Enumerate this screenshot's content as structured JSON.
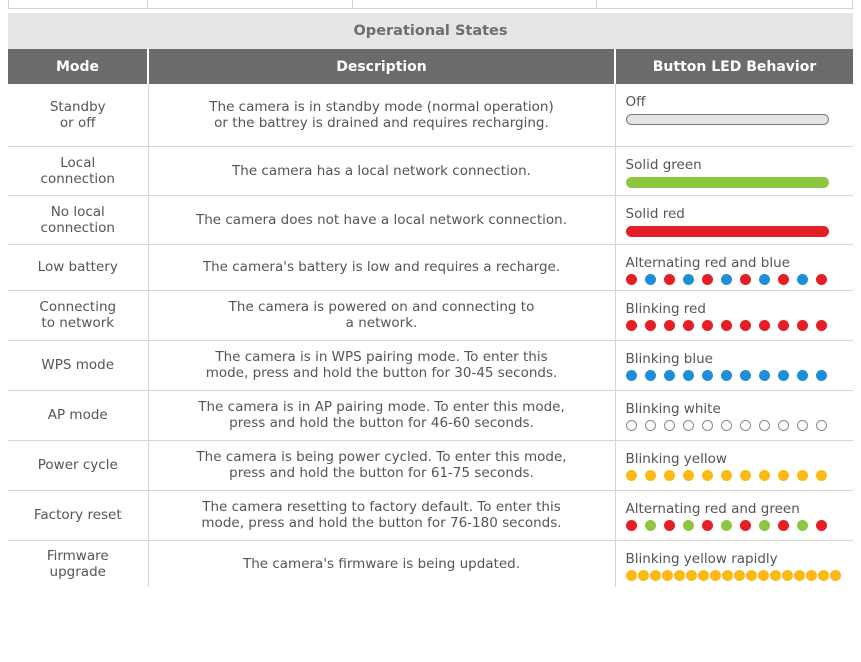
{
  "table": {
    "title": "Operational States",
    "headers": {
      "mode": "Mode",
      "description": "Description",
      "led": "Button LED Behavior"
    },
    "rows": [
      {
        "mode_lines": [
          "Standby",
          "or off"
        ],
        "desc_lines": [
          "The camera is in standby mode (normal operation)",
          "or the battrey is drained and requires recharging."
        ],
        "led_label": "Off",
        "led": {
          "style": "bar",
          "colors": [
            "#e4e4e4"
          ],
          "outline": "#7a7a7a"
        }
      },
      {
        "mode_lines": [
          "Local",
          "connection"
        ],
        "desc_lines": [
          "The camera has a local network connection."
        ],
        "led_label": "Solid green",
        "led": {
          "style": "bar",
          "colors": [
            "#8dc63f"
          ]
        }
      },
      {
        "mode_lines": [
          "No local",
          "connection"
        ],
        "desc_lines": [
          "The camera does not have a local network connection."
        ],
        "led_label": "Solid red",
        "led": {
          "style": "bar",
          "colors": [
            "#e31e24"
          ]
        }
      },
      {
        "mode_lines": [
          "Low battery"
        ],
        "desc_lines": [
          "The camera's battery is low and requires a recharge."
        ],
        "led_label": "Alternating red and blue",
        "led": {
          "style": "dots",
          "count": 11,
          "colors": [
            "#e31e24",
            "#1e8fd6"
          ]
        }
      },
      {
        "mode_lines": [
          "Connecting",
          "to network"
        ],
        "desc_lines": [
          "The camera is powered on and connecting to",
          "a network."
        ],
        "led_label": "Blinking red",
        "led": {
          "style": "dots",
          "count": 11,
          "colors": [
            "#e31e24"
          ]
        }
      },
      {
        "mode_lines": [
          "WPS mode"
        ],
        "desc_lines": [
          "The camera is in WPS pairing mode. To enter this",
          "mode, press and hold the button for 30-45 seconds."
        ],
        "led_label": "Blinking blue",
        "led": {
          "style": "dots",
          "count": 11,
          "colors": [
            "#1e8fd6"
          ]
        }
      },
      {
        "mode_lines": [
          "AP mode"
        ],
        "desc_lines": [
          "The camera is in AP pairing mode. To enter this mode,",
          "press and hold the button for 46-60 seconds."
        ],
        "led_label": "Blinking white",
        "led": {
          "style": "dots",
          "count": 11,
          "colors": [
            "#ffffff"
          ],
          "outline": "#8a8a8a"
        }
      },
      {
        "mode_lines": [
          "Power cycle"
        ],
        "desc_lines": [
          "The camera is being power cycled. To enter this mode,",
          "press and hold the button for 61-75 seconds."
        ],
        "led_label": "Blinking yellow",
        "led": {
          "style": "dots",
          "count": 11,
          "colors": [
            "#fdb913"
          ]
        }
      },
      {
        "mode_lines": [
          "Factory reset"
        ],
        "desc_lines": [
          "The camera resetting to factory default. To enter this",
          "mode, press and hold the button for 76-180 seconds."
        ],
        "led_label": "Alternating red and green",
        "led": {
          "style": "dots",
          "count": 11,
          "colors": [
            "#e31e24",
            "#8dc63f"
          ]
        }
      },
      {
        "mode_lines": [
          "Firmware",
          "upgrade"
        ],
        "desc_lines": [
          "The camera's firmware is being updated."
        ],
        "led_label": "Blinking yellow rapidly",
        "led": {
          "style": "dots-rapid",
          "count": 18,
          "colors": [
            "#fdb913"
          ]
        }
      }
    ]
  }
}
